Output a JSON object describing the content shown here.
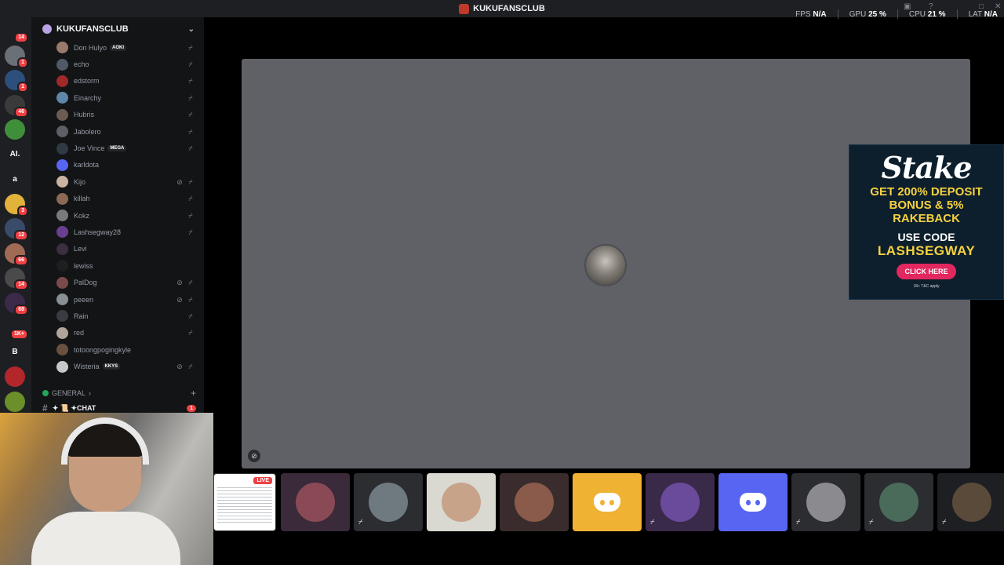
{
  "titlebar": {
    "title": "KUKUFANSCLUB"
  },
  "stats": [
    {
      "label": "FPS",
      "value": "N/A"
    },
    {
      "label": "GPU",
      "value": "25 %"
    },
    {
      "label": "CPU",
      "value": "21 %"
    },
    {
      "label": "LAT",
      "value": "N/A"
    }
  ],
  "rail": [
    {
      "name": "discord-home-icon",
      "glyph": "",
      "color": "#1e1f22",
      "badge": "14"
    },
    {
      "name": "server-icon-1",
      "glyph": "",
      "color": "#6b6f78",
      "badge": "1"
    },
    {
      "name": "server-icon-2",
      "glyph": "",
      "color": "#2c4f7c",
      "badge": "1"
    },
    {
      "name": "server-icon-3",
      "glyph": "",
      "color": "#3a3a3a",
      "badge": "46"
    },
    {
      "name": "server-icon-4",
      "glyph": "",
      "color": "#3f8f3a",
      "badge": ""
    },
    {
      "name": "server-icon-ai",
      "glyph": "AI.",
      "color": "#1e1f22",
      "badge": ""
    },
    {
      "name": "server-icon-a",
      "glyph": "a",
      "color": "#1e1f22",
      "badge": ""
    },
    {
      "name": "server-icon-pikachu",
      "glyph": "",
      "color": "#e2b33a",
      "badge": "3"
    },
    {
      "name": "server-icon-5",
      "glyph": "",
      "color": "#3a4b6a",
      "badge": "12"
    },
    {
      "name": "server-icon-6",
      "glyph": "",
      "color": "#a06a55",
      "badge": "66"
    },
    {
      "name": "server-icon-7",
      "glyph": "",
      "color": "#4a4a4a",
      "badge": "14"
    },
    {
      "name": "server-icon-8",
      "glyph": "",
      "color": "#3c2a4a",
      "badge": "68"
    },
    {
      "name": "server-icon-9",
      "glyph": "",
      "color": "#1e1f22",
      "badge": "1K+"
    },
    {
      "name": "server-icon-b",
      "glyph": "B",
      "color": "#1e1f22",
      "badge": ""
    },
    {
      "name": "server-icon-10",
      "glyph": "",
      "color": "#b3262b",
      "badge": ""
    },
    {
      "name": "server-icon-11",
      "glyph": "",
      "color": "#6a8f2b",
      "badge": ""
    }
  ],
  "server": {
    "name": "KUKUFANSCLUB"
  },
  "members": [
    {
      "name": "Don Hulyo",
      "tag": "AOKI",
      "avatar": "#9a7b6b",
      "mic": true,
      "deaf": false
    },
    {
      "name": "echo",
      "tag": "",
      "avatar": "#4f5a66",
      "mic": true,
      "deaf": false
    },
    {
      "name": "edstorm",
      "tag": "",
      "avatar": "#a02929",
      "mic": true,
      "deaf": false
    },
    {
      "name": "Einarchy",
      "tag": "",
      "avatar": "#5f86a8",
      "mic": true,
      "deaf": false
    },
    {
      "name": "Hubris",
      "tag": "",
      "avatar": "#6b5b52",
      "mic": true,
      "deaf": false
    },
    {
      "name": "Jabolero",
      "tag": "",
      "avatar": "#5c5f64",
      "mic": true,
      "deaf": false
    },
    {
      "name": "Joe Vince",
      "tag": "MEGA",
      "avatar": "#2f3a45",
      "mic": true,
      "deaf": false
    },
    {
      "name": "karldota",
      "tag": "",
      "avatar": "#5865f2",
      "mic": false,
      "deaf": false
    },
    {
      "name": "Kijo",
      "tag": "",
      "avatar": "#c9b3a3",
      "mic": true,
      "deaf": true
    },
    {
      "name": "killah",
      "tag": "",
      "avatar": "#8a6a55",
      "mic": true,
      "deaf": false
    },
    {
      "name": "Kokz",
      "tag": "",
      "avatar": "#7a7a7a",
      "mic": true,
      "deaf": false
    },
    {
      "name": "Lashsegway28",
      "tag": "",
      "avatar": "#6a3f8f",
      "mic": true,
      "deaf": false
    },
    {
      "name": "Levi",
      "tag": "",
      "avatar": "#3a3040",
      "mic": false,
      "deaf": false
    },
    {
      "name": "lewiss",
      "tag": "",
      "avatar": "#1f1f1f",
      "mic": false,
      "deaf": false
    },
    {
      "name": "PalDog",
      "tag": "",
      "avatar": "#7a4a4a",
      "mic": true,
      "deaf": true
    },
    {
      "name": "peeen",
      "tag": "",
      "avatar": "#8a8f94",
      "mic": true,
      "deaf": true
    },
    {
      "name": "Rain",
      "tag": "",
      "avatar": "#3a3c44",
      "mic": true,
      "deaf": false
    },
    {
      "name": "red",
      "tag": "",
      "avatar": "#b0a59a",
      "mic": true,
      "deaf": false
    },
    {
      "name": "totoongpogingkyle",
      "tag": "",
      "avatar": "#6a5040",
      "mic": false,
      "deaf": false
    },
    {
      "name": "Wisteria",
      "tag": "KKYS",
      "avatar": "#c8c8c8",
      "mic": true,
      "deaf": true
    }
  ],
  "category": {
    "label": "GENERAL"
  },
  "channel": {
    "label": "✦ 📜 ✦CHAT",
    "badge": "1"
  },
  "ad": {
    "brand": "Stake",
    "headline": "GET 200% DEPOSIT BONUS & 5% RAKEBACK",
    "use_code": "USE CODE",
    "code": "LASHSEGWAY",
    "cta": "CLICK HERE",
    "fine_print": "18+ T&C apply"
  },
  "live_badge": "LIVE",
  "tiles": [
    {
      "kind": "live",
      "bg": "#ffffff",
      "muted": false
    },
    {
      "kind": "avatar",
      "bg": "#3a2a3a",
      "avatar": "#8a4a55",
      "muted": false
    },
    {
      "kind": "avatar",
      "bg": "#2b2d31",
      "avatar": "#6f7a80",
      "muted": true
    },
    {
      "kind": "avatar",
      "bg": "#d9d9d2",
      "avatar": "#c7a38a",
      "muted": false
    },
    {
      "kind": "avatar",
      "bg": "#3a2c2c",
      "avatar": "#8a5a4a",
      "muted": false
    },
    {
      "kind": "discord",
      "bg": "#f0b232",
      "muted": false
    },
    {
      "kind": "avatar",
      "bg": "#3a2a4a",
      "avatar": "#6a4a9a",
      "muted": true
    },
    {
      "kind": "discord",
      "bg": "#5865f2",
      "muted": false
    },
    {
      "kind": "avatar",
      "bg": "#2b2d31",
      "avatar": "#8a8a8f",
      "muted": true
    },
    {
      "kind": "avatar",
      "bg": "#2b2d31",
      "avatar": "#4a6a5a",
      "muted": true
    },
    {
      "kind": "avatar",
      "bg": "#1e1f22",
      "avatar": "#5a4a3a",
      "muted": true
    }
  ]
}
